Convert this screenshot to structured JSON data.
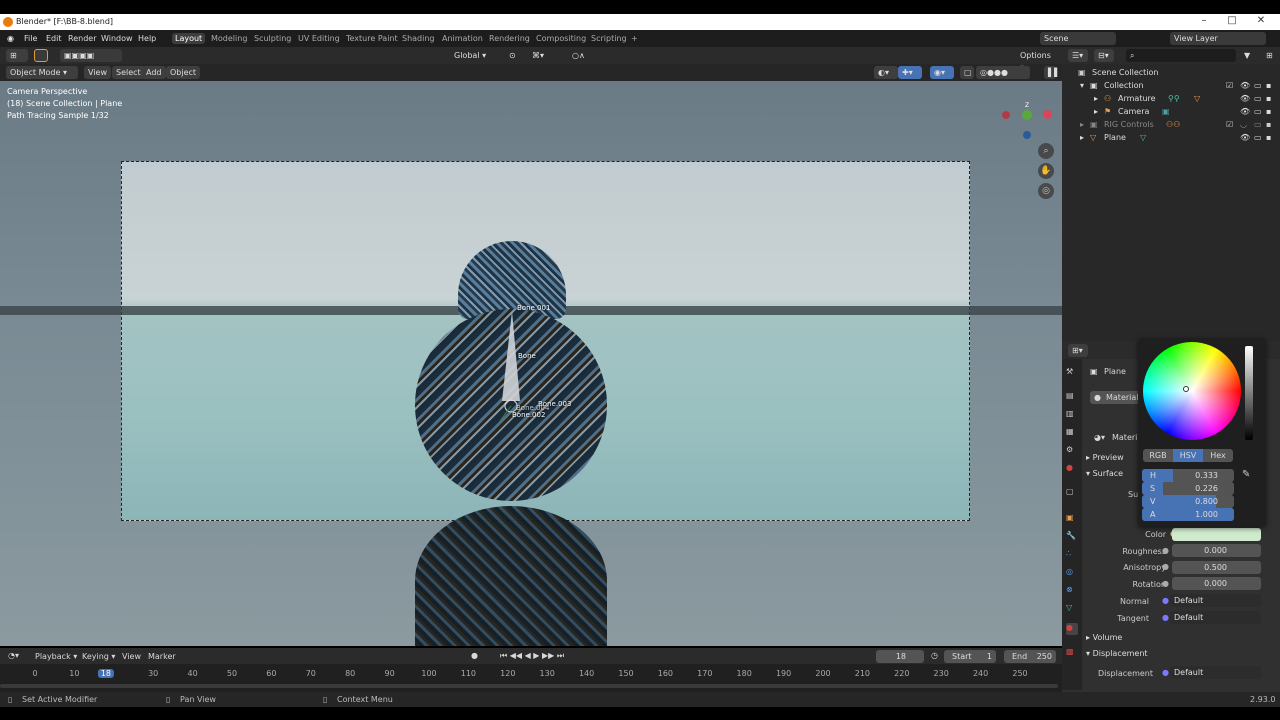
{
  "window": {
    "title": "Blender* [F:\\BB-8.blend]"
  },
  "menu": [
    "File",
    "Edit",
    "Render",
    "Window",
    "Help"
  ],
  "workspaces": [
    "Layout",
    "Modeling",
    "Sculpting",
    "UV Editing",
    "Texture Paint",
    "Shading",
    "Animation",
    "Rendering",
    "Compositing",
    "Scripting",
    "+"
  ],
  "top_right": {
    "scene": "Scene",
    "view_layer": "View Layer"
  },
  "viewport_header": {
    "transform_orientation": "Global",
    "options": "Options"
  },
  "viewport_header2": {
    "mode": "Object Mode",
    "view": "View",
    "select": "Select",
    "add": "Add",
    "object": "Object"
  },
  "overlay_text": [
    "Camera Perspective",
    "(18) Scene Collection | Plane",
    "Path Tracing Sample 1/32"
  ],
  "bones": [
    "Bone.001",
    "Bone",
    "Bone.003",
    "Bone.002",
    "Bone.004"
  ],
  "gizmo": {
    "z": "Z"
  },
  "outliner": {
    "root": "Scene Collection",
    "items": [
      {
        "label": "Collection"
      },
      {
        "label": "Armature"
      },
      {
        "label": "Camera"
      },
      {
        "label": "RIG Controls"
      },
      {
        "label": "Plane"
      }
    ]
  },
  "properties": {
    "object": "Plane",
    "material_slot": "Material",
    "material_name": "Materi",
    "panels": {
      "preview": "Preview",
      "surface": "Surface",
      "volume": "Volume",
      "displacement": "Displacement"
    },
    "surface_cut": "Su",
    "rows": [
      {
        "label": "Color",
        "value": ""
      },
      {
        "label": "Roughness",
        "value": "0.000"
      },
      {
        "label": "Anisotropy",
        "value": "0.500"
      },
      {
        "label": "Rotation",
        "value": "0.000"
      },
      {
        "label": "Normal",
        "value": "Default"
      },
      {
        "label": "Tangent",
        "value": "Default"
      }
    ],
    "displacement_row": {
      "label": "Displacement",
      "value": "Default"
    },
    "color_swatch": "#cfeacd"
  },
  "color_picker": {
    "modes": [
      "RGB",
      "HSV",
      "Hex"
    ],
    "active_mode": "HSV",
    "fields": [
      {
        "k": "H",
        "v": "0.333",
        "fill": 0.333
      },
      {
        "k": "S",
        "v": "0.226",
        "fill": 0.226
      },
      {
        "k": "V",
        "v": "0.800",
        "fill": 0.8
      },
      {
        "k": "A",
        "v": "1.000",
        "fill": 1.0
      }
    ]
  },
  "timeline": {
    "menus": [
      "Playback",
      "Keying",
      "View",
      "Marker"
    ],
    "current_frame": "18",
    "start_label": "Start",
    "start": "1",
    "end_label": "End",
    "end": "250",
    "ticks": [
      "0",
      "10",
      "18",
      "30",
      "40",
      "50",
      "60",
      "70",
      "80",
      "90",
      "100",
      "110",
      "120",
      "130",
      "140",
      "150",
      "160",
      "170",
      "180",
      "190",
      "200",
      "210",
      "220",
      "230",
      "240",
      "250"
    ]
  },
  "status": {
    "left": "Set Active Modifier",
    "mid": "Pan View",
    "right": "Context Menu",
    "version": "2.93.0"
  }
}
